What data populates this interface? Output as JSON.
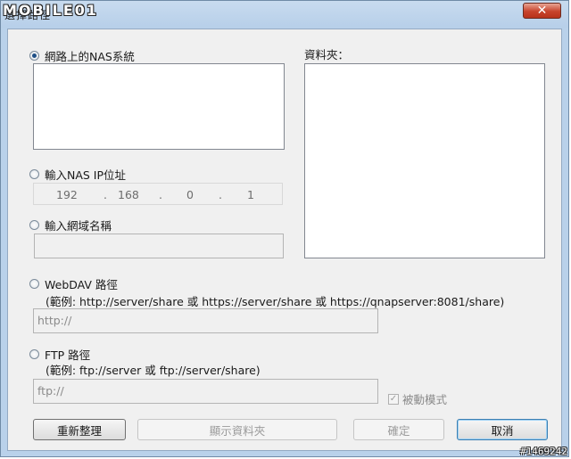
{
  "window": {
    "title": "選擇路徑",
    "close_glyph": "✕",
    "watermark": "MOBILE01"
  },
  "nas": {
    "label": "網路上的NAS系統",
    "selected": true
  },
  "folder": {
    "label": "資料夾："
  },
  "ip": {
    "label": "輸入NAS IP位址",
    "octets": [
      "192",
      "168",
      "0",
      "1"
    ],
    "dot": "."
  },
  "domain": {
    "label": "輸入網域名稱",
    "value": ""
  },
  "webdav": {
    "label": "WebDAV 路徑",
    "hint": "(範例: http://server/share 或 https://server/share 或 https://qnapserver:8081/share)",
    "value": "http://"
  },
  "ftp": {
    "label": "FTP 路徑",
    "hint": "(範例: ftp://server 或 ftp://server/share)",
    "value": "ftp://",
    "passive_label": "被動模式",
    "passive_checked": true
  },
  "buttons": {
    "refresh": "重新整理",
    "show_folder": "顯示資料夾",
    "ok": "確定",
    "cancel": "取消"
  },
  "footer": {
    "post_id": "#1469242"
  }
}
